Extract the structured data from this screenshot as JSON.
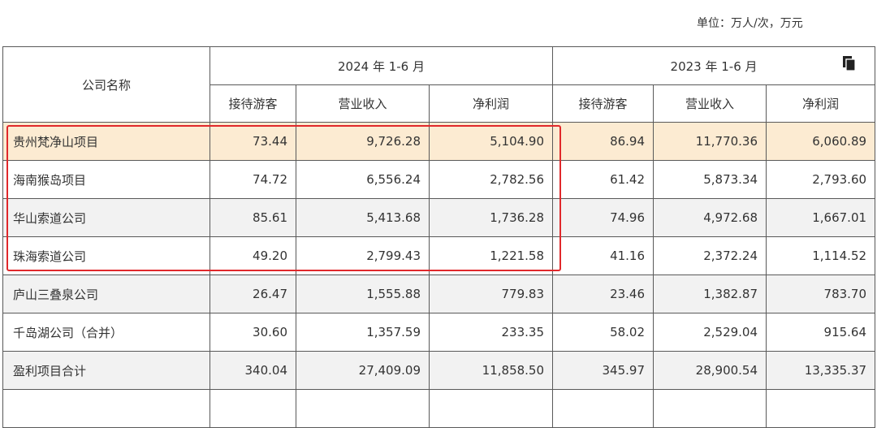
{
  "unit_label": "单位：万人/次，万元",
  "table": {
    "header_company": "公司名称",
    "period_2024": "2024 年 1-6 月",
    "period_2023": "2023 年 1-6 月",
    "sub_headers_2024": [
      "接待游客",
      "营业收入",
      "净利润"
    ],
    "sub_headers_2023": [
      "接待游客",
      "营业收入",
      "净利润"
    ],
    "rows": [
      {
        "name": "贵州梵净山项目",
        "v": [
          "73.44",
          "9,726.28",
          "5,104.90",
          "86.94",
          "11,770.36",
          "6,060.89"
        ]
      },
      {
        "name": "海南猴岛项目",
        "v": [
          "74.72",
          "6,556.24",
          "2,782.56",
          "61.42",
          "5,873.34",
          "2,793.60"
        ]
      },
      {
        "name": "华山索道公司",
        "v": [
          "85.61",
          "5,413.68",
          "1,736.28",
          "74.96",
          "4,972.68",
          "1,667.01"
        ]
      },
      {
        "name": "珠海索道公司",
        "v": [
          "49.20",
          "2,799.43",
          "1,221.58",
          "41.16",
          "2,372.24",
          "1,114.52"
        ]
      },
      {
        "name": "庐山三叠泉公司",
        "v": [
          "26.47",
          "1,555.88",
          "779.83",
          "23.46",
          "1,382.87",
          "783.70"
        ]
      },
      {
        "name": "千岛湖公司（合并）",
        "v": [
          "30.60",
          "1,357.59",
          "233.35",
          "58.02",
          "2,529.04",
          "915.64"
        ]
      },
      {
        "name": "盈利项目合计",
        "v": [
          "340.04",
          "27,409.09",
          "11,858.50",
          "345.97",
          "28,900.54",
          "13,335.37"
        ]
      },
      {
        "name": "",
        "v": [
          "",
          "",
          "",
          "",
          "",
          ""
        ]
      }
    ]
  },
  "icons": {
    "copy": "copy-icon"
  },
  "colors": {
    "highlight_border": "#e0282b",
    "highlight_row": "#fcebd2",
    "alt_row": "#f2f2f2"
  }
}
